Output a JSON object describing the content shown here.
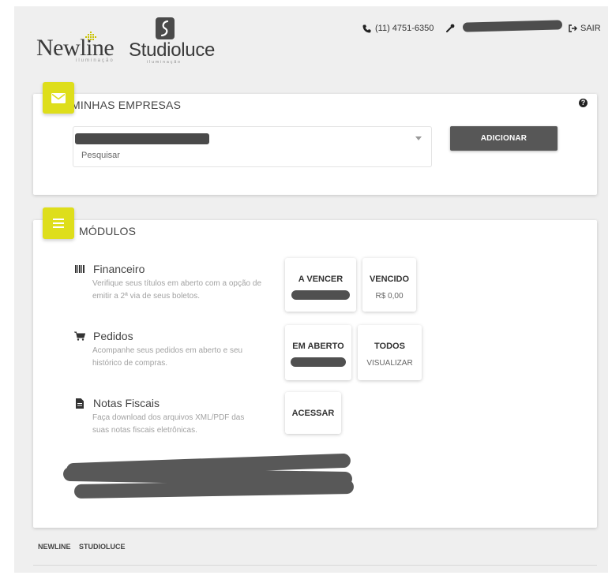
{
  "header": {
    "brand_newline": "Newline",
    "brand_newline_sub": "iluminação",
    "brand_studioluce": "Studioluce",
    "brand_studioluce_sub": "iluminação",
    "phone": "(11) 4751-6350",
    "logout_label": "SAIR"
  },
  "companies_card": {
    "title": "MINHAS EMPRESAS",
    "help": "?",
    "search_placeholder": "Pesquisar",
    "add_button": "ADICIONAR"
  },
  "modules_card": {
    "title": "MÓDULOS",
    "modules": [
      {
        "title": "Financeiro",
        "description": "Verifique seus títulos em aberto com a opção de emitir a 2ª via de seus boletos.",
        "icon": "barcode-icon",
        "tiles": [
          {
            "label": "A VENCER"
          },
          {
            "label": "VENCIDO",
            "sub": "R$ 0,00"
          }
        ]
      },
      {
        "title": "Pedidos",
        "description": "Acompanhe seus pedidos em aberto e seu histórico de compras.",
        "icon": "cart-icon",
        "tiles": [
          {
            "label": "EM ABERTO"
          },
          {
            "label": "TODOS",
            "sub": "VISUALIZAR"
          }
        ]
      },
      {
        "title": "Notas Fiscais",
        "description": "Faça download dos arquivos XML/PDF das suas notas fiscais eletrônicas.",
        "icon": "document-icon",
        "tiles": [
          {
            "label": "ACESSAR"
          }
        ]
      }
    ]
  },
  "footer": {
    "links": [
      "NEWLINE",
      "STUDIOLUCE"
    ]
  },
  "colors": {
    "accent": "#dede1b",
    "button": "#575757",
    "page_background": "#efefef"
  }
}
